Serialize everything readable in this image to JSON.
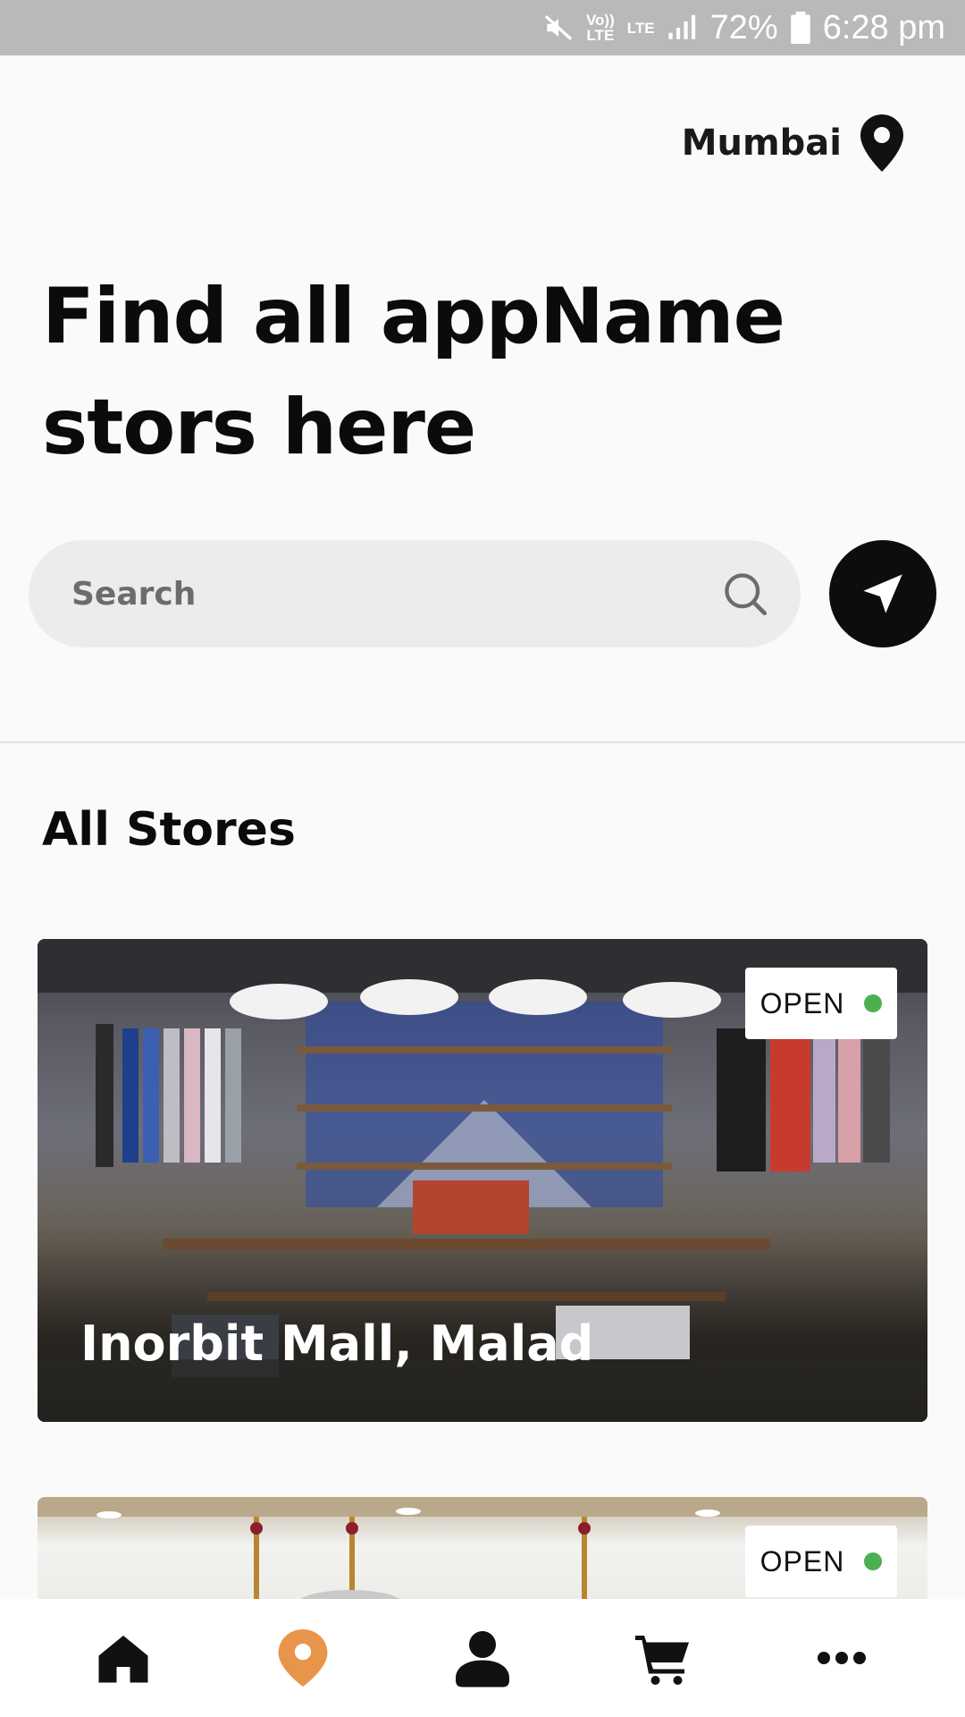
{
  "status_bar": {
    "volte": "Vo))\nLTE",
    "lte": "LTE",
    "battery": "72%",
    "time": "6:28 pm"
  },
  "location": {
    "city": "Mumbai",
    "icon": "map-pin-icon"
  },
  "headline": "Find all appName stors here",
  "search": {
    "placeholder": "Search"
  },
  "section_title": "All Stores",
  "stores": [
    {
      "name": "Inorbit Mall, Malad",
      "status": "OPEN",
      "status_color": "#4caf50"
    },
    {
      "name": "",
      "status": "OPEN",
      "status_color": "#4caf50"
    }
  ],
  "nav": {
    "items": [
      {
        "icon": "home-icon",
        "active": false
      },
      {
        "icon": "location-pin-icon",
        "active": true
      },
      {
        "icon": "profile-icon",
        "active": false
      },
      {
        "icon": "cart-icon",
        "active": false
      },
      {
        "icon": "more-icon",
        "active": false
      }
    ],
    "active_color": "#e8954b"
  }
}
